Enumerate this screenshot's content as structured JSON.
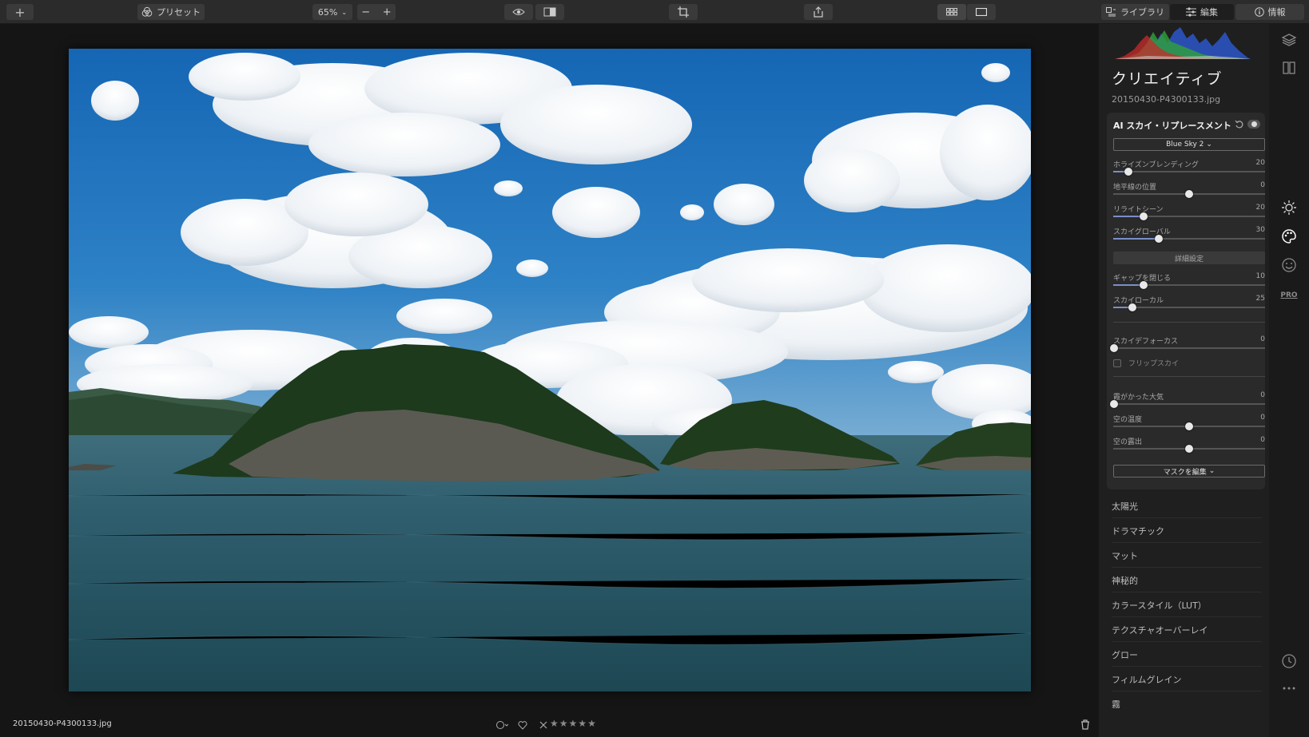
{
  "toolbar": {
    "add_label": "+",
    "presets_label": "プリセット",
    "zoom_value": "65%",
    "zoom_out_label": "−",
    "zoom_in_label": "+",
    "tabs": [
      {
        "label": "ライブラリ",
        "active": false
      },
      {
        "label": "編集",
        "active": true
      },
      {
        "label": "情報",
        "active": false
      }
    ]
  },
  "panel": {
    "title": "クリエイティブ",
    "filename": "20150430-P4300133.jpg",
    "ai_sky": {
      "title": "AI スカイ・リプレースメント",
      "sky_select": "Blue Sky 2",
      "sliders": [
        {
          "label": "ホライズンブレンディング",
          "value": 20,
          "pos": 0.1
        },
        {
          "label": "地平線の位置",
          "value": 0,
          "pos": 0.5
        },
        {
          "label": "リライトシーン",
          "value": 20,
          "pos": 0.2
        },
        {
          "label": "スカイグローバル",
          "value": 30,
          "pos": 0.3
        }
      ],
      "advanced_label": "詳細設定",
      "advanced_sliders": [
        {
          "label": "ギャップを閉じる",
          "value": 10,
          "pos": 0.2
        },
        {
          "label": "スカイローカル",
          "value": 25,
          "pos": 0.125
        }
      ],
      "defocus": {
        "label": "スカイデフォーカス",
        "value": 0,
        "pos": 0.0
      },
      "flip_label": "フリップスカイ",
      "atmosphere_sliders": [
        {
          "label": "霞がかった大気",
          "value": 0,
          "pos": 0.0
        },
        {
          "label": "空の温度",
          "value": 0,
          "pos": 0.5
        },
        {
          "label": "空の露出",
          "value": 0,
          "pos": 0.5
        }
      ],
      "mask_label": "マスクを編集"
    },
    "tools": [
      "太陽光",
      "ドラマチック",
      "マット",
      "神秘的",
      "カラースタイル（LUT）",
      "テクスチャオーバーレイ",
      "グロー",
      "フィルムグレイン",
      "霧"
    ]
  },
  "bottom": {
    "filename": "20150430-P4300133.jpg",
    "rating": 0,
    "max_rating": 5
  },
  "colors": {
    "accent": "#7b8ec8",
    "background": "#121212",
    "panel": "#1f1f1f"
  },
  "rail_icons": [
    "layers-icon",
    "compare-icon",
    "sun-icon",
    "palette-icon",
    "face-icon",
    "pro-icon",
    "history-icon",
    "more-icon"
  ]
}
